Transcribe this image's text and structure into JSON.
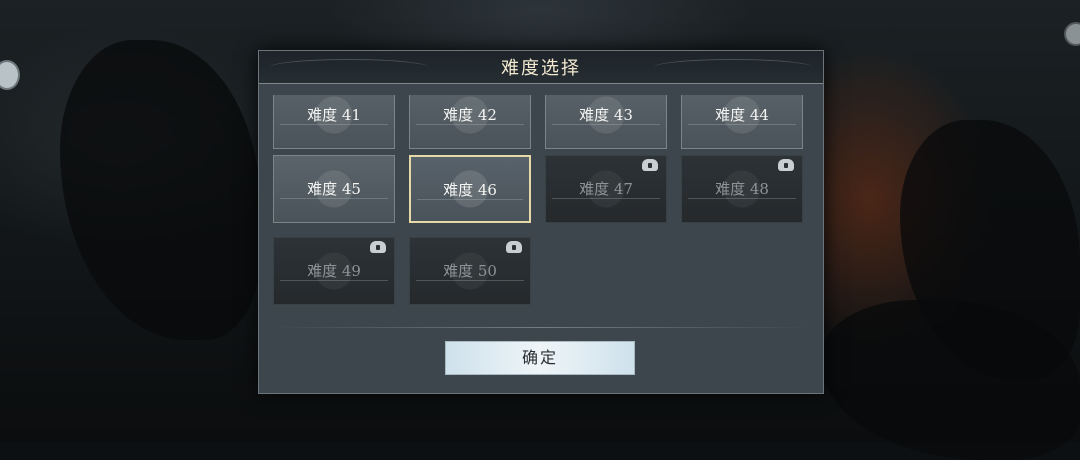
{
  "dialog": {
    "title": "难度选择",
    "confirm_label": "确定"
  },
  "difficulties": [
    {
      "label": "难度 41",
      "locked": false,
      "selected": false
    },
    {
      "label": "难度 42",
      "locked": false,
      "selected": false
    },
    {
      "label": "难度 43",
      "locked": false,
      "selected": false
    },
    {
      "label": "难度 44",
      "locked": false,
      "selected": false
    },
    {
      "label": "难度 45",
      "locked": false,
      "selected": false
    },
    {
      "label": "难度 46",
      "locked": false,
      "selected": true
    },
    {
      "label": "难度 47",
      "locked": true,
      "selected": false
    },
    {
      "label": "难度 48",
      "locked": true,
      "selected": false
    },
    {
      "label": "难度 49",
      "locked": true,
      "selected": false
    },
    {
      "label": "难度 50",
      "locked": true,
      "selected": false
    }
  ],
  "icons": {
    "lock": "lock-icon"
  },
  "colors": {
    "selected_border": "#e6d9a8",
    "title_text": "#f3e9d0",
    "confirm_bg": "#e4eef3"
  }
}
